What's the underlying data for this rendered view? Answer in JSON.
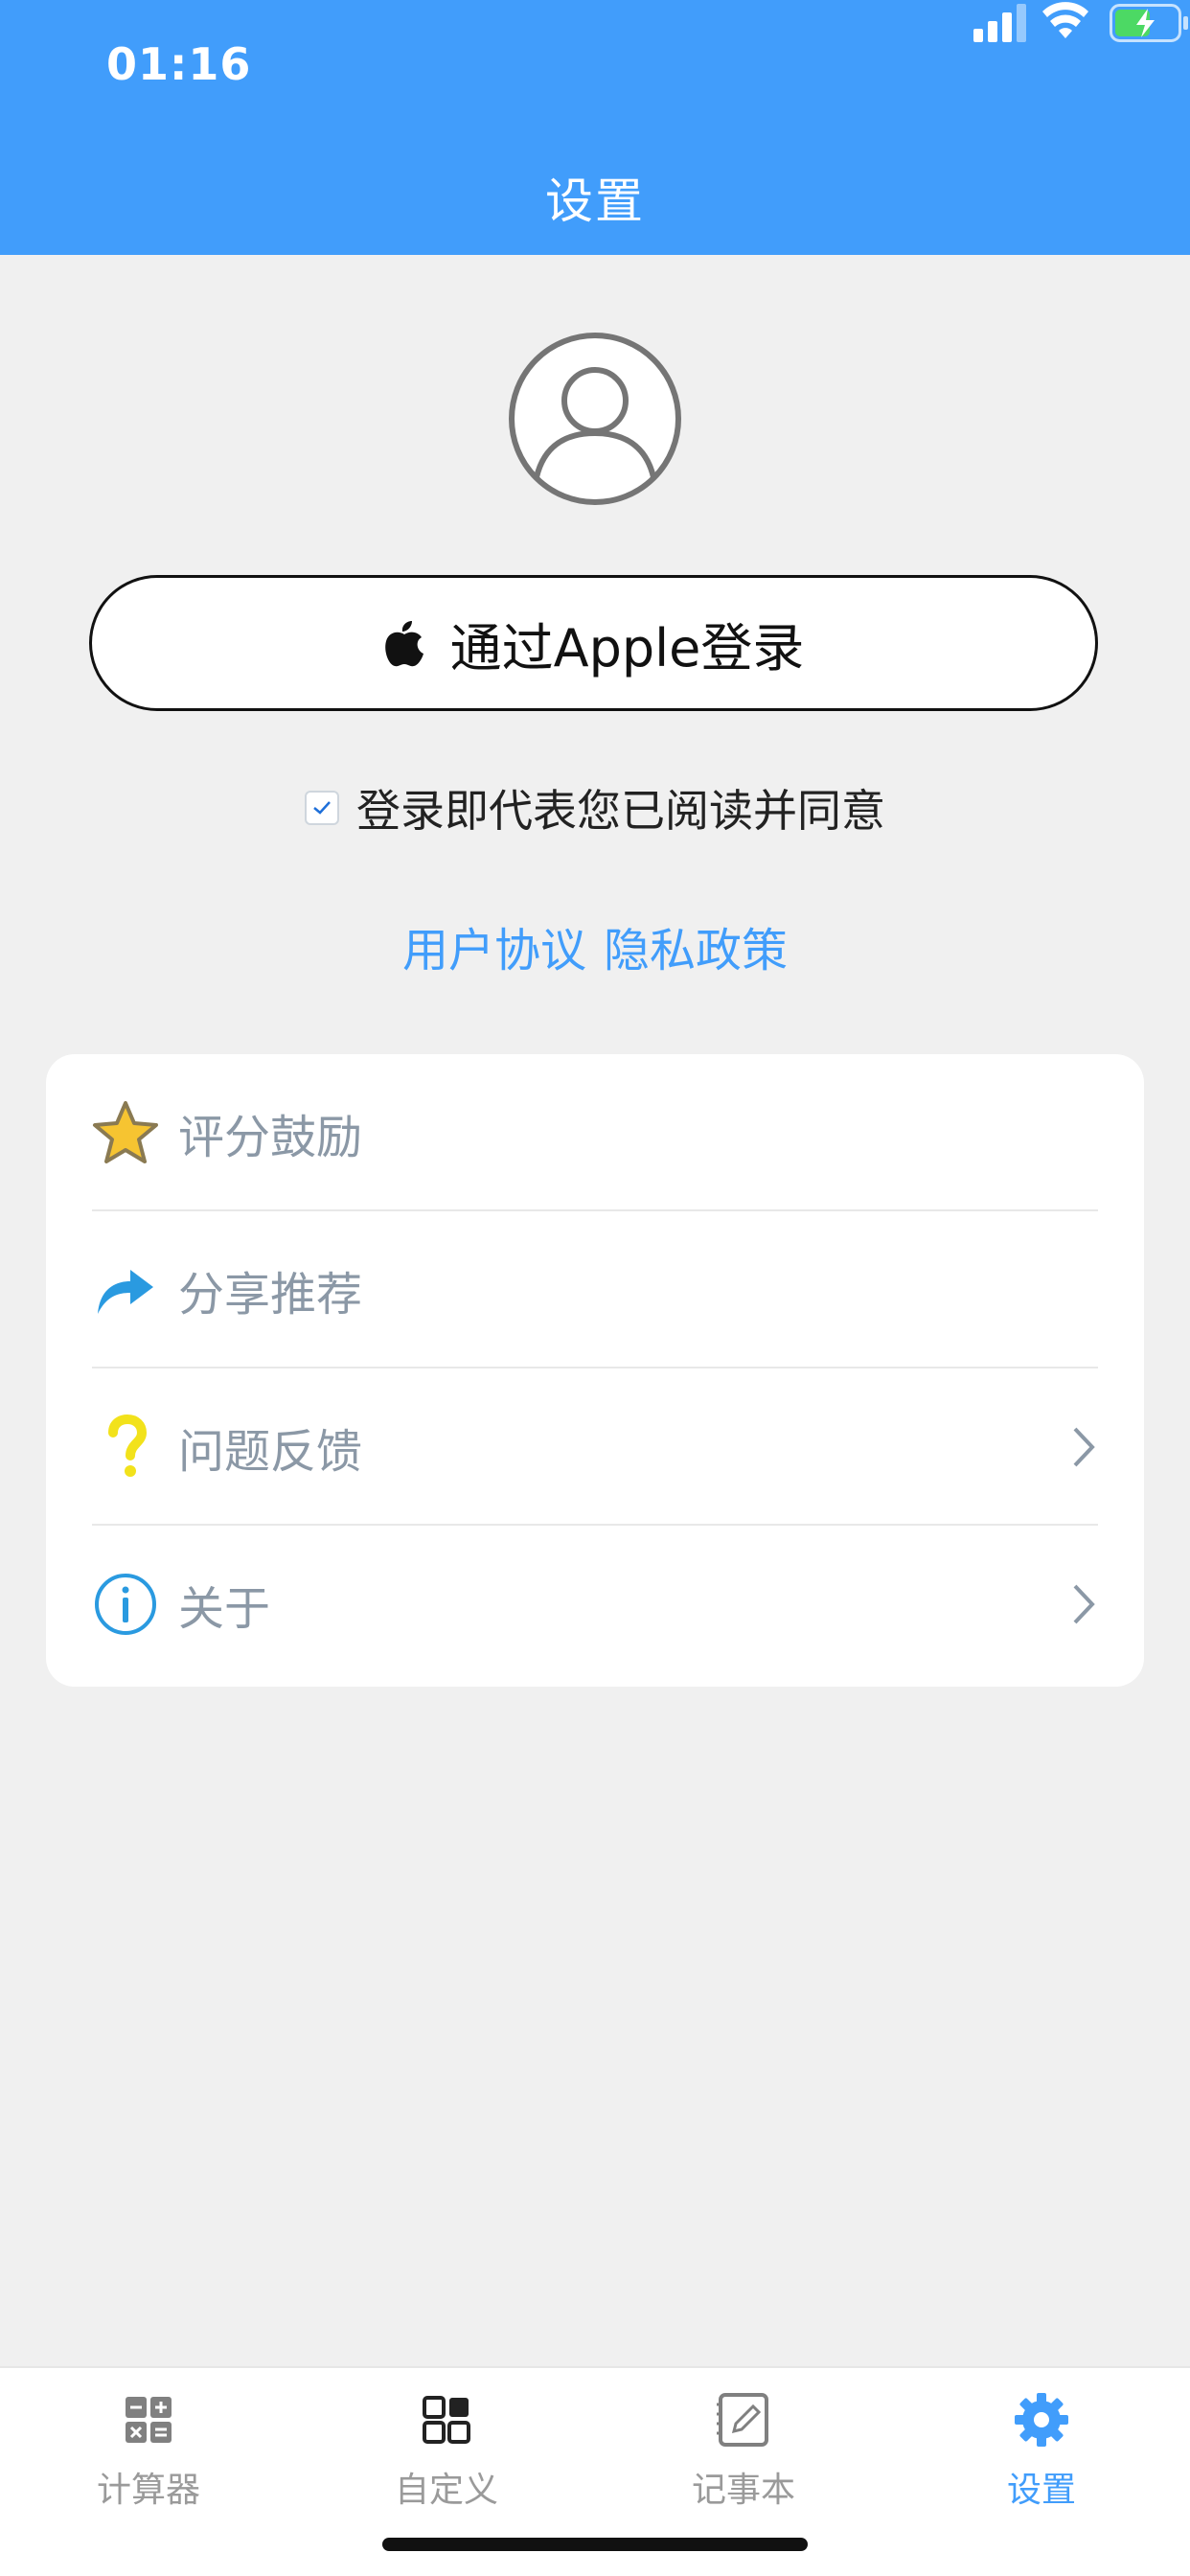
{
  "status_bar": {
    "time": "01:16"
  },
  "nav": {
    "title": "设置"
  },
  "login": {
    "apple_button_label": "通过Apple登录",
    "agree_text": "登录即代表您已阅读并同意",
    "agree_checked": true,
    "links": {
      "user_agreement": "用户协议",
      "privacy_policy": "隐私政策"
    }
  },
  "menu": {
    "items": [
      {
        "label": "评分鼓励",
        "icon": "star-icon",
        "has_chevron": false
      },
      {
        "label": "分享推荐",
        "icon": "share-arrow-icon",
        "has_chevron": false
      },
      {
        "label": "问题反馈",
        "icon": "question-icon",
        "has_chevron": true
      },
      {
        "label": "关于",
        "icon": "info-icon",
        "has_chevron": true
      }
    ]
  },
  "tabbar": {
    "tabs": [
      {
        "label": "计算器",
        "icon": "calculator-icon",
        "active": false
      },
      {
        "label": "自定义",
        "icon": "grid-icon",
        "active": false
      },
      {
        "label": "记事本",
        "icon": "notepad-icon",
        "active": false
      },
      {
        "label": "设置",
        "icon": "gear-icon",
        "active": true
      }
    ]
  },
  "colors": {
    "accent": "#419dfb",
    "background": "#f0f0f0",
    "menu_text": "#8b98a6"
  }
}
